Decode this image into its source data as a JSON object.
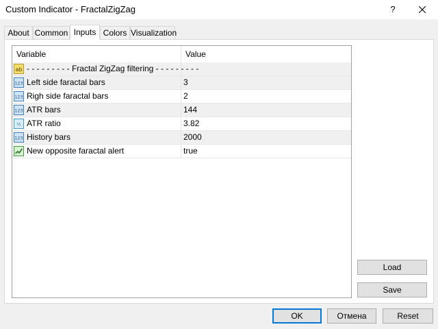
{
  "window": {
    "title": "Custom Indicator - FractalZigZag",
    "help_label": "?"
  },
  "tabs": [
    {
      "label": "About"
    },
    {
      "label": "Common"
    },
    {
      "label": "Inputs"
    },
    {
      "label": "Colors"
    },
    {
      "label": "Visualization"
    }
  ],
  "active_tab": "Inputs",
  "grid": {
    "headers": {
      "variable": "Variable",
      "value": "Value"
    },
    "rows": [
      {
        "icon": "ab-string-icon",
        "variable": "- - - - - - - - - Fractal ZigZag filtering - - - - - - - - -",
        "value": ""
      },
      {
        "icon": "integer-icon",
        "variable": "Left side faractal bars",
        "value": "3"
      },
      {
        "icon": "integer-icon",
        "variable": "Righ side faractal bars",
        "value": "2"
      },
      {
        "icon": "integer-icon",
        "variable": "ATR bars",
        "value": "144"
      },
      {
        "icon": "double-icon",
        "variable": "ATR ratio",
        "value": "3.82"
      },
      {
        "icon": "integer-icon",
        "variable": "History bars",
        "value": "2000"
      },
      {
        "icon": "bool-icon",
        "variable": "New opposite faractal alert",
        "value": "true"
      }
    ]
  },
  "side_buttons": {
    "load": "Load",
    "save": "Save"
  },
  "footer_buttons": {
    "ok": "OK",
    "cancel": "Отмена",
    "reset": "Reset"
  },
  "colors": {
    "accent": "#0078d7",
    "icon_int": "#4a90d9",
    "icon_ab": "#e8c84a",
    "icon_bool": "#3c9a3c"
  }
}
